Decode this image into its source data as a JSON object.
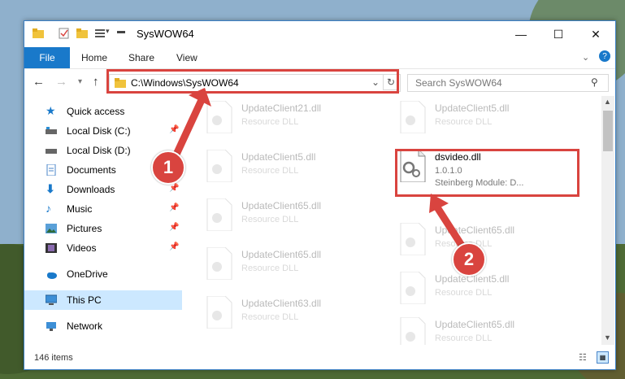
{
  "window": {
    "title": "SysWOW64",
    "minimize": "—",
    "maximize": "☐",
    "close": "✕"
  },
  "ribbon": {
    "tabs": [
      "File",
      "Home",
      "Share",
      "View"
    ],
    "help": "?"
  },
  "navbar": {
    "address": "C:\\Windows\\SysWOW64",
    "search_placeholder": "Search SysWOW64"
  },
  "sidebar": {
    "items": [
      {
        "label": "Quick access",
        "icon": "star-icon",
        "pinned": false
      },
      {
        "label": "Local Disk (C:)",
        "icon": "drive-icon",
        "pinned": true
      },
      {
        "label": "Local Disk (D:)",
        "icon": "drive-icon",
        "pinned": false
      },
      {
        "label": "Documents",
        "icon": "documents-icon",
        "pinned": true
      },
      {
        "label": "Downloads",
        "icon": "download-icon",
        "pinned": true
      },
      {
        "label": "Music",
        "icon": "music-icon",
        "pinned": true
      },
      {
        "label": "Pictures",
        "icon": "pictures-icon",
        "pinned": true
      },
      {
        "label": "Videos",
        "icon": "videos-icon",
        "pinned": true
      },
      {
        "label": "OneDrive",
        "icon": "cloud-icon",
        "pinned": false
      },
      {
        "label": "This PC",
        "icon": "computer-icon",
        "pinned": false,
        "selected": true
      },
      {
        "label": "Network",
        "icon": "network-icon",
        "pinned": false
      }
    ]
  },
  "files": {
    "left": [
      {
        "name": "UpdateClient21.dll",
        "desc": "Resource DLL"
      },
      {
        "name": "UpdateClient5.dll",
        "desc": "Resource DLL"
      },
      {
        "name": "UpdateClient65.dll",
        "desc": "Resource DLL"
      },
      {
        "name": "UpdateClient65.dll",
        "desc": "Resource DLL"
      },
      {
        "name": "UpdateClient63.dll",
        "desc": "Resource DLL"
      }
    ],
    "right": [
      {
        "name": "UpdateClient5.dll",
        "desc": "Resource DLL"
      },
      {
        "name": "UpdateClient65.dll",
        "desc": "Resource DLL"
      },
      {
        "name": "UpdateClient5.dll",
        "desc": "Resource DLL"
      },
      {
        "name": "UpdateClient65.dll",
        "desc": "Resource DLL"
      }
    ],
    "highlight": {
      "name": "dsvideo.dll",
      "version": "1.0.1.0",
      "desc": "Steinberg Module: D..."
    }
  },
  "status": {
    "count": "146 items"
  },
  "annotations": {
    "step1": "1",
    "step2": "2"
  },
  "colors": {
    "accent": "#1979ca",
    "annotation": "#d9443f",
    "selected": "#cce8ff"
  }
}
